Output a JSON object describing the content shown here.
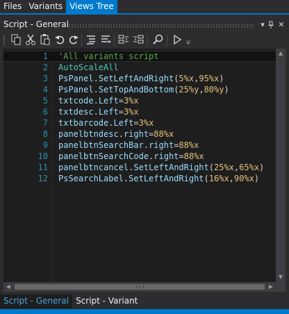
{
  "top_tabs": [
    {
      "label": "Files"
    },
    {
      "label": "Variants"
    },
    {
      "label": "Views Tree"
    }
  ],
  "panel": {
    "title": "Script - General",
    "dropdown_icon": "chevron-down-icon",
    "pin_icon": "pin-icon"
  },
  "toolbar": {
    "buttons": [
      "copy-icon",
      "cut-icon",
      "paste-icon",
      "undo-icon",
      "redo-icon",
      "comment-block-icon",
      "uncomment-block-icon",
      "outdent-icon",
      "indent-icon",
      "find-icon",
      "run-icon"
    ],
    "overflow_icon": "toolbar-overflow-icon"
  },
  "editor": {
    "current_line": 1,
    "lines": [
      {
        "num": "1",
        "tokens": [
          {
            "t": "'All variants script",
            "c": "comment"
          }
        ]
      },
      {
        "num": "2",
        "tokens": [
          {
            "t": "AutoScaleAll",
            "c": "kw"
          }
        ]
      },
      {
        "num": "3",
        "tokens": [
          {
            "t": "PsPanel",
            "c": "ident"
          },
          {
            "t": ".",
            "c": "op"
          },
          {
            "t": "SetLeftAndRight",
            "c": "ident"
          },
          {
            "t": "(",
            "c": "op"
          },
          {
            "t": "5%x",
            "c": "num"
          },
          {
            "t": ",",
            "c": "op"
          },
          {
            "t": "95%x",
            "c": "num"
          },
          {
            "t": ")",
            "c": "op"
          }
        ]
      },
      {
        "num": "4",
        "tokens": [
          {
            "t": "PsPanel",
            "c": "ident"
          },
          {
            "t": ".",
            "c": "op"
          },
          {
            "t": "SetTopAndBottom",
            "c": "ident"
          },
          {
            "t": "(",
            "c": "op"
          },
          {
            "t": "25%y",
            "c": "num"
          },
          {
            "t": ",",
            "c": "op"
          },
          {
            "t": "80%y",
            "c": "num"
          },
          {
            "t": ")",
            "c": "op"
          }
        ]
      },
      {
        "num": "5",
        "tokens": [
          {
            "t": "txtcode",
            "c": "ident"
          },
          {
            "t": ".",
            "c": "op"
          },
          {
            "t": "Left",
            "c": "ident"
          },
          {
            "t": "=",
            "c": "op"
          },
          {
            "t": "3%x",
            "c": "num"
          }
        ]
      },
      {
        "num": "6",
        "tokens": [
          {
            "t": "txtdesc",
            "c": "ident"
          },
          {
            "t": ".",
            "c": "op"
          },
          {
            "t": "Left",
            "c": "ident"
          },
          {
            "t": "=",
            "c": "op"
          },
          {
            "t": "3%x",
            "c": "num"
          }
        ]
      },
      {
        "num": "7",
        "tokens": [
          {
            "t": "txtbarcode",
            "c": "ident"
          },
          {
            "t": ".",
            "c": "op"
          },
          {
            "t": "Left",
            "c": "ident"
          },
          {
            "t": "=",
            "c": "op"
          },
          {
            "t": "3%x",
            "c": "num"
          }
        ]
      },
      {
        "num": "8",
        "tokens": [
          {
            "t": "panelbtndesc",
            "c": "ident"
          },
          {
            "t": ".",
            "c": "op"
          },
          {
            "t": "right",
            "c": "ident"
          },
          {
            "t": "=",
            "c": "op"
          },
          {
            "t": "88%x",
            "c": "num"
          }
        ]
      },
      {
        "num": "9",
        "tokens": [
          {
            "t": "panelbtnSearchBar",
            "c": "ident"
          },
          {
            "t": ".",
            "c": "op"
          },
          {
            "t": "right",
            "c": "ident"
          },
          {
            "t": "=",
            "c": "op"
          },
          {
            "t": "88%x",
            "c": "num"
          }
        ]
      },
      {
        "num": "10",
        "tokens": [
          {
            "t": "panelbtnSearchCode",
            "c": "ident"
          },
          {
            "t": ".",
            "c": "op"
          },
          {
            "t": "right",
            "c": "ident"
          },
          {
            "t": "=",
            "c": "op"
          },
          {
            "t": "88%x",
            "c": "num"
          }
        ]
      },
      {
        "num": "11",
        "tokens": [
          {
            "t": "panelbtncancel",
            "c": "ident"
          },
          {
            "t": ".",
            "c": "op"
          },
          {
            "t": "SetLeftAndRight",
            "c": "ident"
          },
          {
            "t": "(",
            "c": "op"
          },
          {
            "t": "25%x",
            "c": "num"
          },
          {
            "t": ",",
            "c": "op"
          },
          {
            "t": "65%x",
            "c": "num"
          },
          {
            "t": ")",
            "c": "op"
          }
        ]
      },
      {
        "num": "12",
        "tokens": [
          {
            "t": "PsSearchLabel",
            "c": "ident"
          },
          {
            "t": ".",
            "c": "op"
          },
          {
            "t": "SetLeftAndRight",
            "c": "ident"
          },
          {
            "t": "(",
            "c": "op"
          },
          {
            "t": "16%x",
            "c": "num"
          },
          {
            "t": ",",
            "c": "op"
          },
          {
            "t": "90%x",
            "c": "num"
          },
          {
            "t": ")",
            "c": "op"
          }
        ]
      }
    ]
  },
  "bottom_tabs": [
    {
      "label": "Script - General"
    },
    {
      "label": "Script - Variant"
    }
  ],
  "colors": {
    "accent": "#007acc",
    "background": "#2d2d30",
    "editor_bg": "#1e1e1e",
    "line_number": "#2b91af",
    "identifier": "#9cdcfe",
    "number": "#e5c07b",
    "comment": "#57a64a",
    "keyword": "#4ec9b0"
  }
}
